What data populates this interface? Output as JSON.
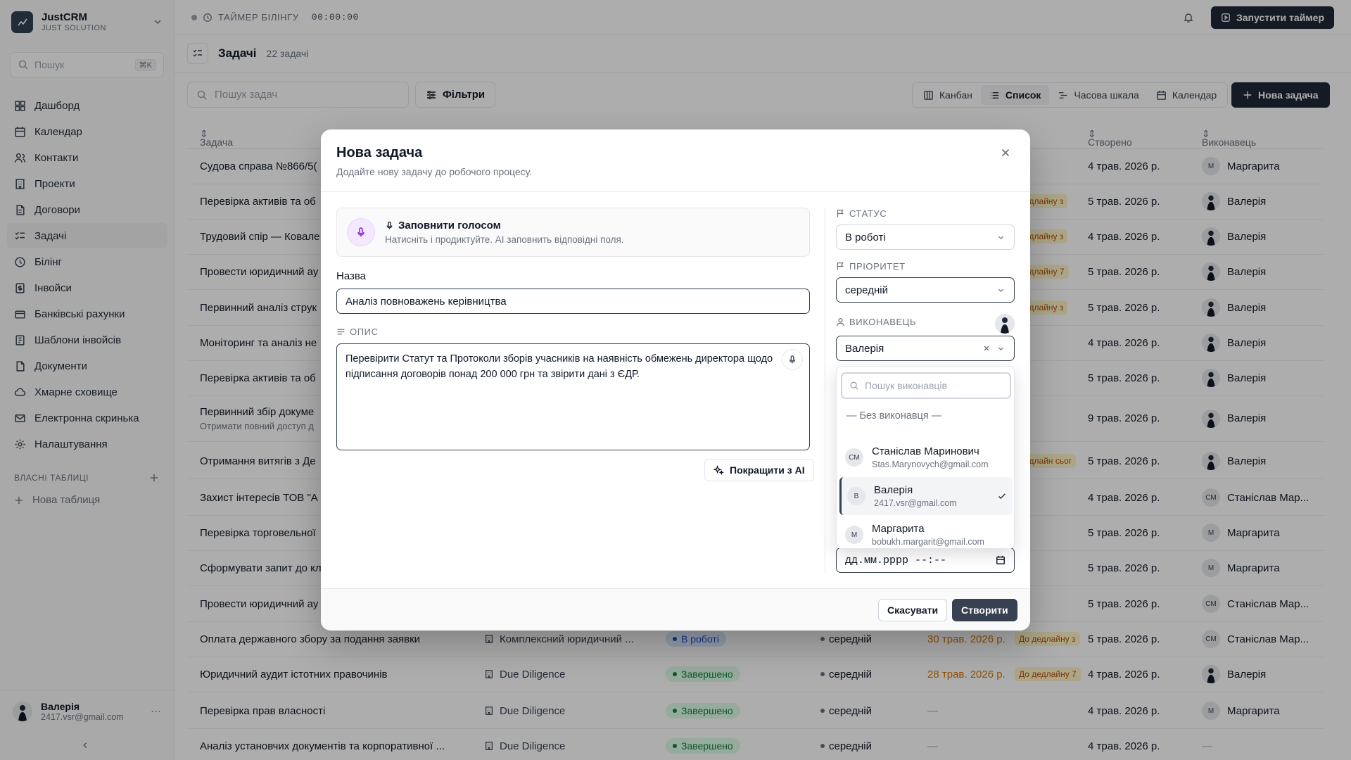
{
  "app": {
    "name": "JustCRM",
    "subtitle": "JUST SOLUTION"
  },
  "sidebar": {
    "search_placeholder": "Пошук",
    "search_kbd": "⌘K",
    "items": [
      {
        "label": "Дашборд",
        "icon": "dashboard-icon"
      },
      {
        "label": "Календар",
        "icon": "calendar-icon"
      },
      {
        "label": "Контакти",
        "icon": "users-icon"
      },
      {
        "label": "Проекти",
        "icon": "building-icon"
      },
      {
        "label": "Договори",
        "icon": "contract-icon"
      },
      {
        "label": "Задачі",
        "icon": "tasks-icon",
        "active": true
      },
      {
        "label": "Білінг",
        "icon": "clock-icon"
      },
      {
        "label": "Інвойси",
        "icon": "invoice-icon"
      },
      {
        "label": "Банківські рахунки",
        "icon": "bank-icon"
      },
      {
        "label": "Шаблони інвойсів",
        "icon": "template-icon"
      },
      {
        "label": "Документи",
        "icon": "document-icon"
      },
      {
        "label": "Хмарне сховище",
        "icon": "cloud-icon"
      },
      {
        "label": "Електронна скринька",
        "icon": "mail-icon"
      },
      {
        "label": "Налаштування",
        "icon": "gear-icon"
      }
    ],
    "own_tables_title": "ВЛАСНІ ТАБЛИЦІ",
    "new_table": "Нова таблиця",
    "user": {
      "name": "Валерія",
      "email": "2417.vsr@gmail.com"
    }
  },
  "topbar": {
    "timer_label": "ТАЙМЕР БІЛІНГУ",
    "timer_value": "00:00:00",
    "start_timer": "Запустити таймер"
  },
  "page": {
    "title": "Задачі",
    "count": "22 задачі",
    "search_placeholder": "Пошук задач",
    "filters": "Фільтри",
    "views": [
      "Канбан",
      "Список",
      "Часова шкала",
      "Календар"
    ],
    "active_view": "Список",
    "new_task": "Нова задача"
  },
  "table": {
    "headers": {
      "task": "Задача",
      "created": "Створено",
      "assignee": "Виконавець"
    },
    "rows": [
      {
        "title": "Судова справа №866/5(",
        "created": "4 трав. 2026 р.",
        "assignee": "Маргарита",
        "initials": "М"
      },
      {
        "title": "Перевірка активів та об",
        "tag": "Дедлайну з",
        "created": "5 трав. 2026 р.",
        "assignee": "Валерія",
        "photo": true
      },
      {
        "title": "Трудовий спір — Ковале",
        "tag": "Дедлайну з",
        "created": "4 трав. 2026 р.",
        "assignee": "Валерія",
        "photo": true
      },
      {
        "title": "Провести юридичний ау",
        "tag": "Дедлайну 7",
        "created": "5 трав. 2026 р.",
        "assignee": "Валерія",
        "photo": true
      },
      {
        "title": "Первинний аналіз струк",
        "tag": "Дедлайну з",
        "created": "5 трав. 2026 р.",
        "assignee": "Валерія",
        "photo": true
      },
      {
        "title": "Моніторинг та аналіз не",
        "created": "4 трав. 2026 р.",
        "assignee": "Валерія",
        "photo": true
      },
      {
        "title": "Перевірка активів та об",
        "created": "5 трав. 2026 р.",
        "assignee": "Валерія",
        "photo": true
      },
      {
        "title": "Первинний збір докуме",
        "sub": "Отримати повний доступ д",
        "created": "9 трав. 2026 р.",
        "assignee": "Валерія",
        "photo": true
      },
      {
        "title": "Отримання витягів з Де",
        "tag": "Дедлайн сьог",
        "created": "5 трав. 2026 р.",
        "assignee": "Валерія",
        "photo": true
      },
      {
        "title": "Захист інтересів ТОВ \"А",
        "created": "4 трав. 2026 р.",
        "assignee": "Станіслав Мар...",
        "initials": "СМ"
      },
      {
        "title": "Перевірка торговельної",
        "created": "5 трав. 2026 р.",
        "assignee": "Маргарита",
        "initials": "М"
      },
      {
        "title": "Сформувати запит до кл",
        "created": "5 трав. 2026 р.",
        "assignee": "Маргарита",
        "initials": "М"
      },
      {
        "title": "Провести юридичний ау",
        "created": "5 трав. 2026 р.",
        "assignee": "Станіслав Мар...",
        "initials": "СМ"
      },
      {
        "title": "Оплата державного збору за подання заявки",
        "project": "Комплексний юридичний ...",
        "status": "В роботі",
        "status_color": "blue",
        "priority": "середній",
        "due": "30 трав. 2026 р.",
        "tag": "До дедлайну з",
        "created": "5 трав. 2026 р.",
        "assignee": "Станіслав Мар...",
        "initials": "СМ"
      },
      {
        "title": "Юридичний аудит істотних правочинів",
        "project": "Due Diligence",
        "status": "Завершено",
        "status_color": "green",
        "priority": "середній",
        "due": "28 трав. 2026 р.",
        "tag": "До дедлайну 7",
        "created": "4 трав. 2026 р.",
        "assignee": "Валерія",
        "photo": true
      },
      {
        "title": "Перевірка прав власності",
        "project": "Due Diligence",
        "status": "Завершено",
        "status_color": "green",
        "priority": "середній",
        "due": "—",
        "created": "4 трав. 2026 р.",
        "assignee": "Маргарита",
        "initials": "М"
      },
      {
        "title": "Аналіз установчих документів та корпоративної ...",
        "project": "Due Diligence",
        "status": "Завершено",
        "status_color": "green",
        "priority": "середній",
        "due": "—",
        "created": "4 трав. 2026 р.",
        "assignee": "—"
      }
    ]
  },
  "modal": {
    "title": "Нова задача",
    "subtitle": "Додайте нову задачу до робочого процесу.",
    "voice_title": "Заповнити голосом",
    "voice_desc": "Натисніть і продиктуйте. AI заповнить відповідні поля.",
    "name_label": "Назва",
    "name_value": "Аналіз повноважень керівництва",
    "desc_label": "ОПИС",
    "desc_value": "Перевірити Статут та Протоколи зборів учасників на наявність обмежень директора щодо підписання договорів понад 200 000 грн та звірити дані з ЄДР.",
    "improve": "Покращити з AI",
    "status_label": "СТАТУС",
    "status_value": "В роботі",
    "priority_label": "ПРІОРИТЕТ",
    "priority_value": "середній",
    "assignee_label": "ВИКОНАВЕЦЬ",
    "assignee_value": "Валерія",
    "date_placeholder": "дд.мм.рррр --:--",
    "cancel": "Скасувати",
    "create": "Створити"
  },
  "dropdown": {
    "search_placeholder": "Пошук виконавців",
    "none": "— Без виконавця —",
    "options": [
      {
        "initials": "СМ",
        "name": "Станіслав Маринович",
        "email": "Stas.Marynovych@gmail.com"
      },
      {
        "initials": "В",
        "name": "Валерія",
        "email": "2417.vsr@gmail.com",
        "selected": true
      },
      {
        "initials": "М",
        "name": "Маргарита",
        "email": "bobukh.margarit@gmail.com"
      }
    ]
  }
}
